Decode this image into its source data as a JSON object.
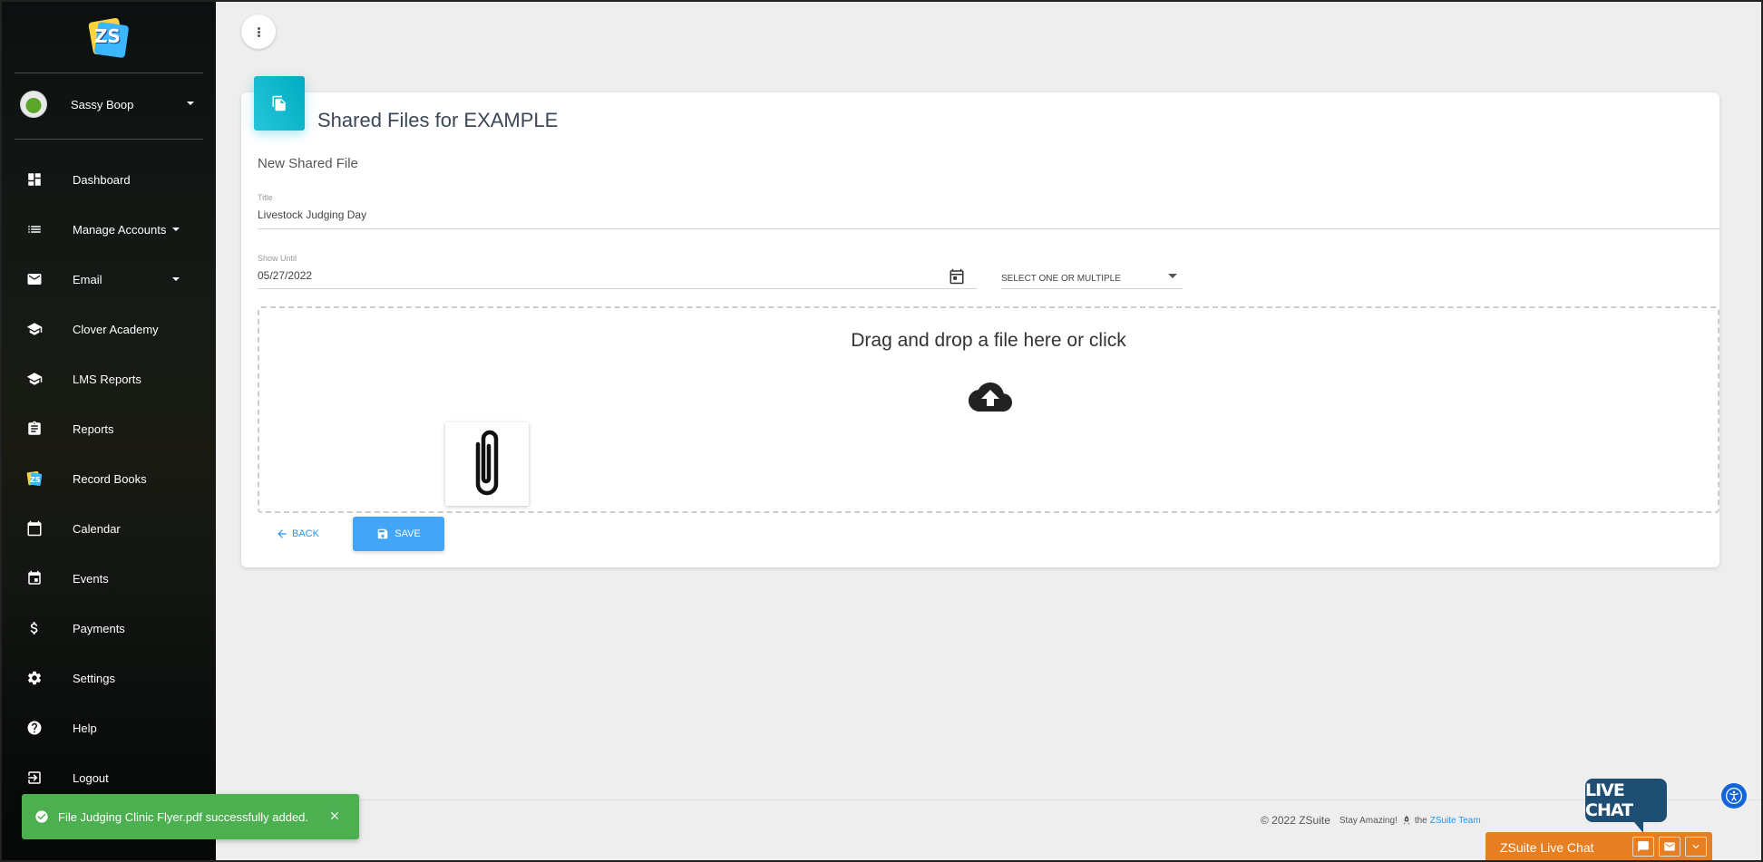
{
  "sidebar": {
    "logo_text": "ZS",
    "user": {
      "name": "Sassy Boop"
    },
    "items": [
      {
        "label": "Dashboard",
        "icon": "dashboard-icon",
        "has_caret": false
      },
      {
        "label": "Manage Accounts",
        "icon": "list-icon",
        "has_caret": true
      },
      {
        "label": "Email",
        "icon": "email-icon",
        "has_caret": true
      },
      {
        "label": "Clover Academy",
        "icon": "school-icon",
        "has_caret": false
      },
      {
        "label": "LMS Reports",
        "icon": "school-icon",
        "has_caret": false
      },
      {
        "label": "Reports",
        "icon": "clipboard-icon",
        "has_caret": false
      },
      {
        "label": "Record Books",
        "icon": "zsuite-logo-icon",
        "has_caret": false
      },
      {
        "label": "Calendar",
        "icon": "calendar-icon",
        "has_caret": false
      },
      {
        "label": "Events",
        "icon": "event-icon",
        "has_caret": false
      },
      {
        "label": "Payments",
        "icon": "dollar-icon",
        "has_caret": false
      },
      {
        "label": "Settings",
        "icon": "gear-icon",
        "has_caret": false
      },
      {
        "label": "Help",
        "icon": "help-icon",
        "has_caret": false
      },
      {
        "label": "Logout",
        "icon": "logout-icon",
        "has_caret": false
      }
    ]
  },
  "card": {
    "title": "Shared Files for EXAMPLE",
    "section_title": "New Shared File",
    "title_field": {
      "label": "Title",
      "value": "Livestock Judging Day"
    },
    "show_until": {
      "label": "Show Until",
      "value": "05/27/2022"
    },
    "select": {
      "placeholder": "SELECT ONE OR MULTIPLE"
    },
    "dropzone": {
      "text": "Drag and drop a file here or click"
    },
    "back_label": "BACK",
    "save_label": "SAVE"
  },
  "footer": {
    "copyright": "© 2022 ZSuite",
    "tagline": "Stay Amazing!",
    "the": "the",
    "team_link": "ZSuite Team"
  },
  "toast": {
    "message": "File Judging Clinic Flyer.pdf successfully added."
  },
  "live_chat": {
    "bubble_text": "LIVE CHAT",
    "bar_label": "ZSuite Live Chat"
  },
  "colors": {
    "accent_cyan": "#00acc1",
    "save_blue": "#42a5f5",
    "toast_green": "#4caf50",
    "chat_orange": "#e67e22",
    "chat_bubble": "#1e4f73"
  }
}
